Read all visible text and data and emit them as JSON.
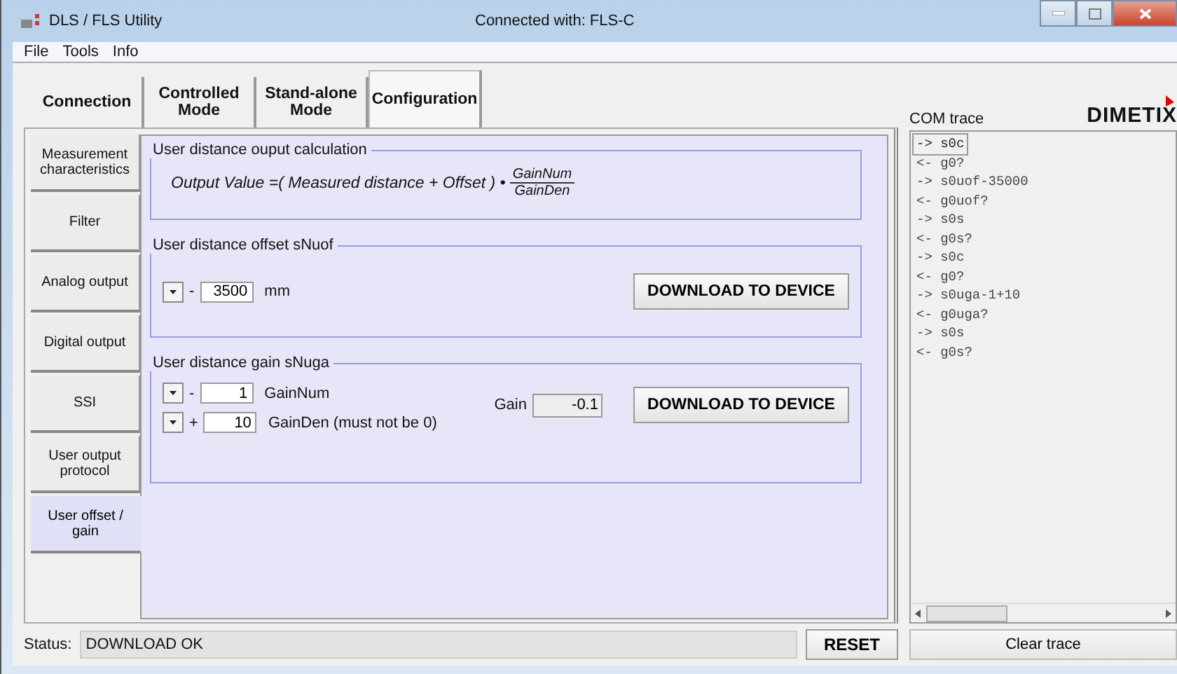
{
  "window": {
    "title": "DLS / FLS Utility",
    "connection": "Connected with: FLS-C"
  },
  "menu": [
    "File",
    "Tools",
    "Info"
  ],
  "tabs": [
    {
      "label": "Connection",
      "selected": false
    },
    {
      "label": "Controlled Mode",
      "selected": false
    },
    {
      "label": "Stand-alone Mode",
      "selected": false
    },
    {
      "label": "Configuration",
      "selected": true
    }
  ],
  "side_tabs": [
    {
      "label": "Measurement characteristics",
      "selected": false
    },
    {
      "label": "Filter",
      "selected": false
    },
    {
      "label": "Analog output",
      "selected": false
    },
    {
      "label": "Digital output",
      "selected": false
    },
    {
      "label": "SSI",
      "selected": false
    },
    {
      "label": "User output protocol",
      "selected": false
    },
    {
      "label": "User offset / gain",
      "selected": true
    }
  ],
  "calculation": {
    "title": "User distance ouput calculation",
    "formula": "Output Value =( Measured distance + Offset ) •",
    "numerator": "GainNum",
    "denominator": "GainDen"
  },
  "offset": {
    "title": "User distance offset sNuof",
    "sign": "-",
    "value": "3500",
    "unit": "mm",
    "button": "DOWNLOAD TO DEVICE"
  },
  "gain": {
    "title": "User distance gain sNuga",
    "rows": [
      {
        "sign": "-",
        "value": "1",
        "label": "GainNum"
      },
      {
        "sign": "+",
        "value": "10",
        "label": "GainDen (must not be 0)"
      }
    ],
    "gain_label": "Gain",
    "gain_value": "-0.1",
    "button": "DOWNLOAD TO DEVICE"
  },
  "com_trace": {
    "title": "COM trace",
    "logo": "DIMETIX",
    "lines": [
      {
        "text": "-> s0c",
        "selected": true
      },
      {
        "text": "<- g0?",
        "selected": false
      },
      {
        "text": "-> s0uof-35000",
        "selected": false
      },
      {
        "text": "<- g0uof?",
        "selected": false
      },
      {
        "text": "-> s0s",
        "selected": false
      },
      {
        "text": "<- g0s?",
        "selected": false
      },
      {
        "text": "-> s0c",
        "selected": false
      },
      {
        "text": "<- g0?",
        "selected": false
      },
      {
        "text": "-> s0uga-1+10",
        "selected": false
      },
      {
        "text": "<- g0uga?",
        "selected": false
      },
      {
        "text": "-> s0s",
        "selected": false
      },
      {
        "text": "<- g0s?",
        "selected": false
      }
    ],
    "clear_button": "Clear trace"
  },
  "status_bar": {
    "label": "Status:",
    "value": "DOWNLOAD OK",
    "reset_button": "RESET"
  }
}
